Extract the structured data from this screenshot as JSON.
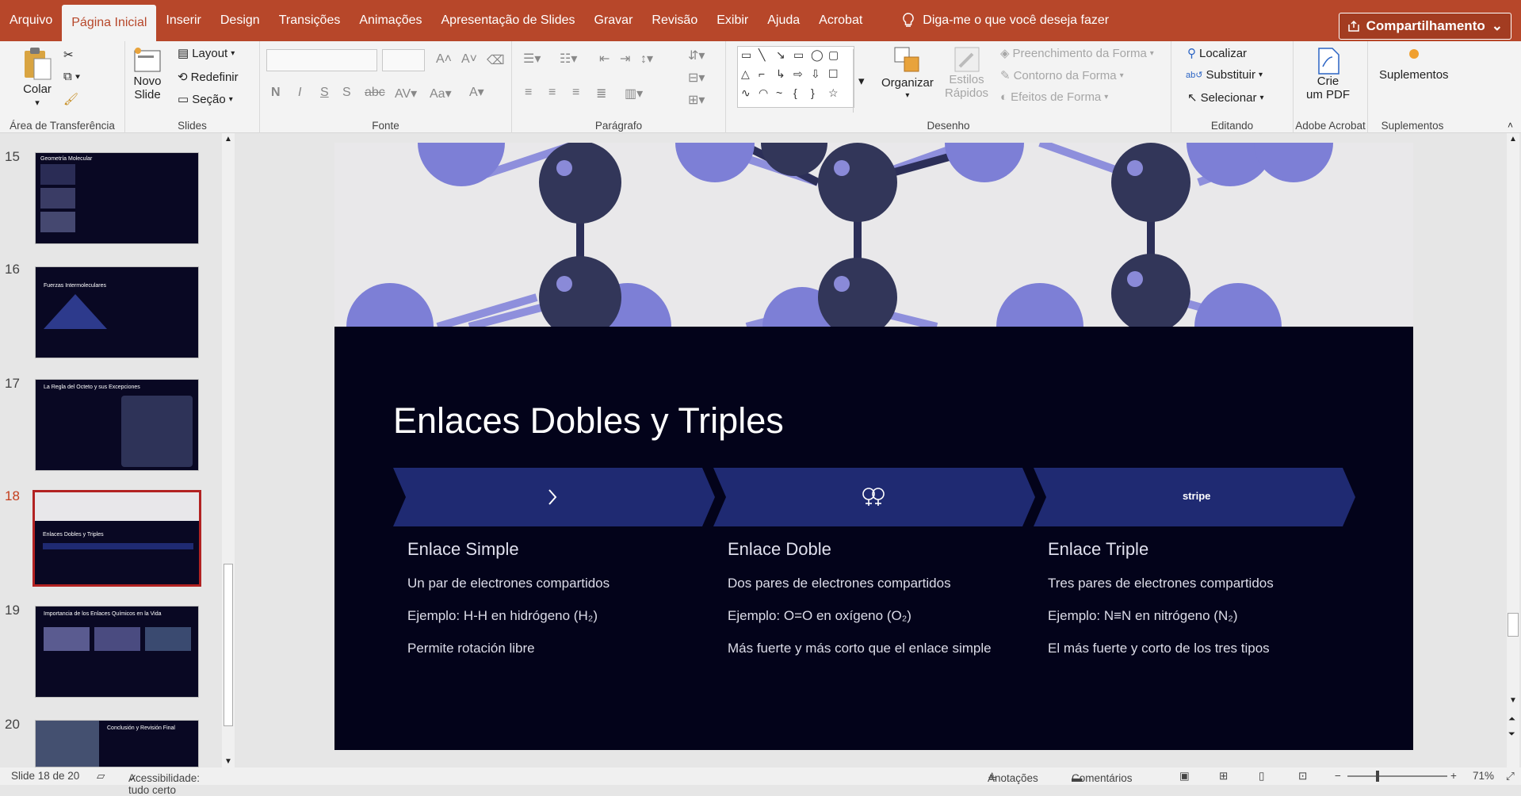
{
  "menubar": {
    "tabs": [
      "Arquivo",
      "Página Inicial",
      "Inserir",
      "Design",
      "Transições",
      "Animações",
      "Apresentação de Slides",
      "Gravar",
      "Revisão",
      "Exibir",
      "Ajuda",
      "Acrobat"
    ],
    "tell_me": "Diga-me o que você deseja fazer",
    "share": "Compartilhamento"
  },
  "ribbon": {
    "clipboard": {
      "paste": "Colar",
      "label": "Área de Transferência"
    },
    "slides": {
      "new_slide_1": "Novo",
      "new_slide_2": "Slide",
      "layout": "Layout",
      "reset": "Redefinir",
      "section": "Seção",
      "label": "Slides"
    },
    "font": {
      "label": "Fonte"
    },
    "paragraph": {
      "label": "Parágrafo"
    },
    "drawing": {
      "arrange": "Organizar",
      "quick_styles_1": "Estilos",
      "quick_styles_2": "Rápidos",
      "fill": "Preenchimento da Forma",
      "outline": "Contorno da Forma",
      "effects": "Efeitos de Forma",
      "label": "Desenho"
    },
    "editing": {
      "find": "Localizar",
      "replace": "Substituir",
      "select": "Selecionar",
      "label": "Editando"
    },
    "acrobat": {
      "create_1": "Crie",
      "create_2": "um PDF",
      "label": "Adobe Acrobat"
    },
    "addins": {
      "button": "Suplementos",
      "label": "Suplementos"
    }
  },
  "thumbnails": [
    {
      "number": "15",
      "title": "Geometría Molecular"
    },
    {
      "number": "16",
      "title": "Fuerzas Intermoleculares"
    },
    {
      "number": "17",
      "title": "La Regla del Octeto y sus Excepciones"
    },
    {
      "number": "18",
      "title": "Enlaces Dobles y Triples"
    },
    {
      "number": "19",
      "title": "Importancia de los Enlaces Químicos en la Vida"
    },
    {
      "number": "20",
      "title": "Conclusión y Revisión Final"
    }
  ],
  "slide": {
    "title": "Enlaces Dobles y Triples",
    "chevron_3_text": "stripe",
    "columns": [
      {
        "heading": "Enlace Simple",
        "lines": [
          "Un par de electrones compartidos",
          "Ejemplo: H-H en hidrógeno (H₂)",
          "Permite rotación libre"
        ]
      },
      {
        "heading": "Enlace Doble",
        "lines": [
          "Dos pares de electrones compartidos",
          "Ejemplo: O=O en oxígeno (O₂)",
          "Más fuerte y más corto que el enlace simple"
        ]
      },
      {
        "heading": "Enlace Triple",
        "lines": [
          "Tres pares de electrones compartidos",
          "Ejemplo: N≡N en nitrógeno (N₂)",
          "El más fuerte y corto de los tres tipos"
        ]
      }
    ]
  },
  "status": {
    "slide": "Slide 18 de 20",
    "accessibility": "Acessibilidade: tudo certo",
    "notes": "Anotações",
    "comments": "Comentários",
    "zoom": "71%"
  },
  "colors": {
    "accent": "#b7472a",
    "slide_bg": "#03031a",
    "chevron": "#1f2a72",
    "selected_thumb": "#b22222"
  }
}
